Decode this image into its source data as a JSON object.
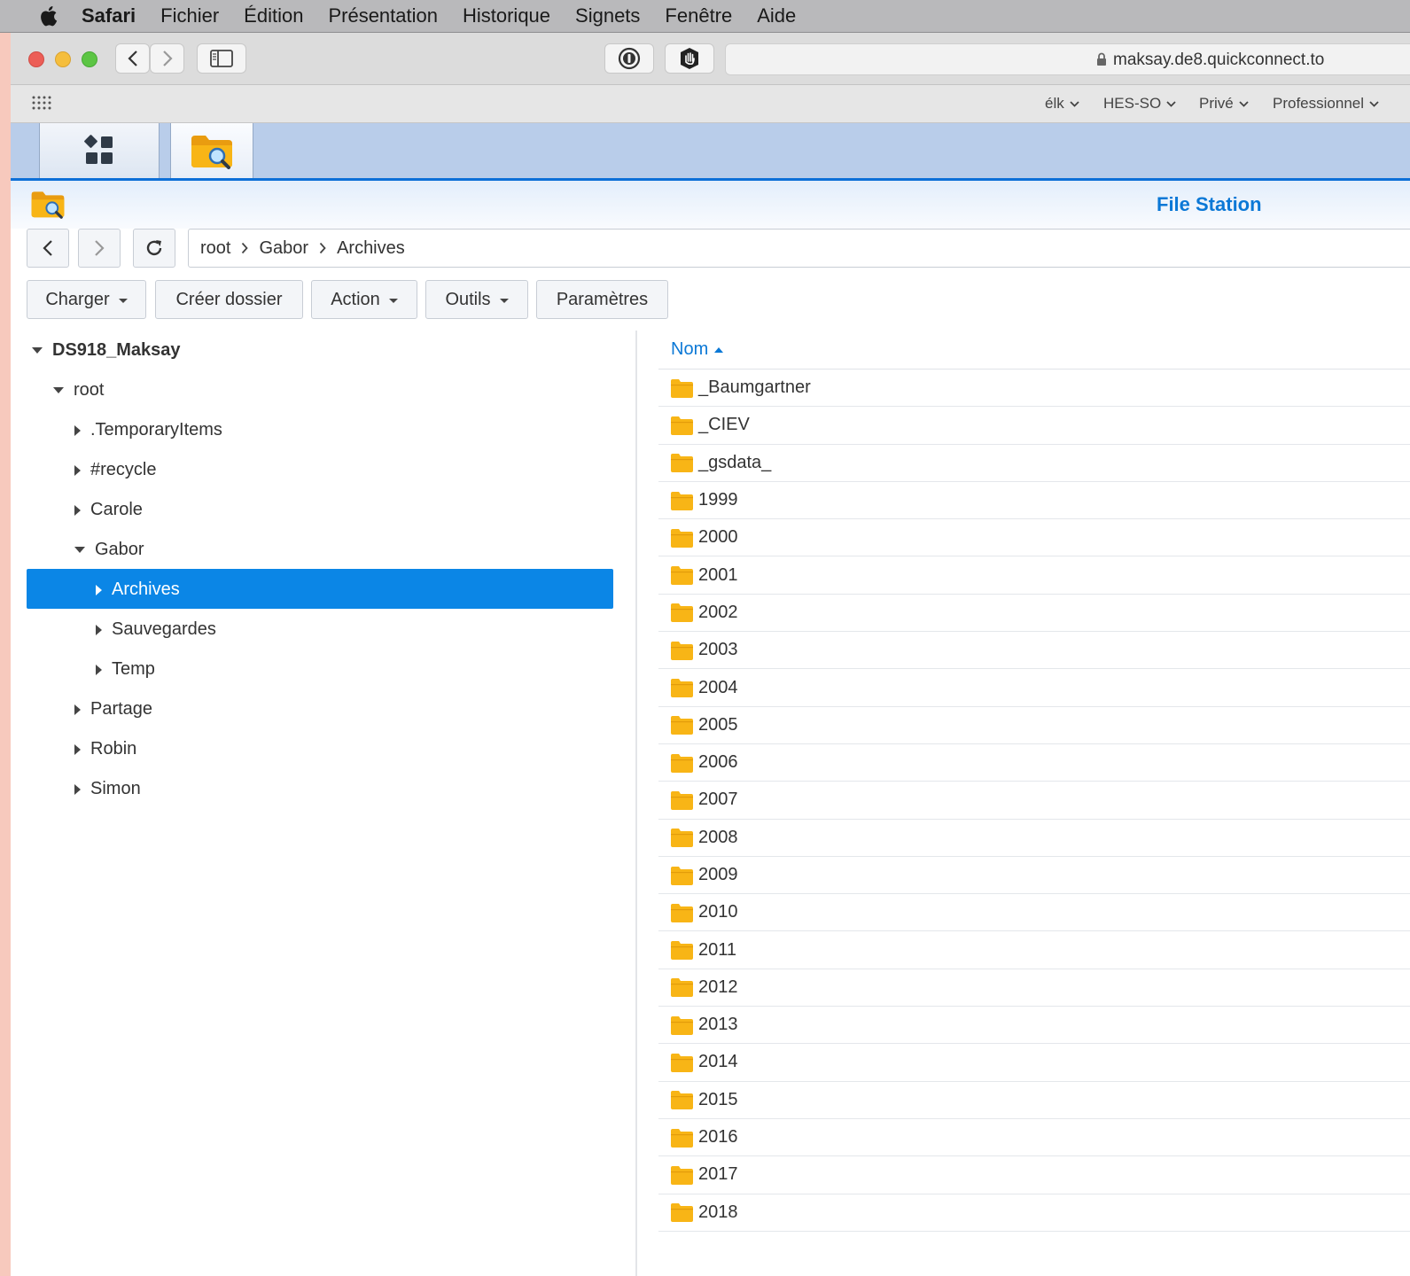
{
  "menubar": {
    "app_name": "Safari",
    "items": [
      "Fichier",
      "Édition",
      "Présentation",
      "Historique",
      "Signets",
      "Fenêtre",
      "Aide"
    ]
  },
  "browser": {
    "url": "maksay.de8.quickconnect.to",
    "favorites": [
      "élk",
      "HES-SO",
      "Privé",
      "Professionnel"
    ]
  },
  "dsm": {
    "app_title": "File Station",
    "breadcrumb": [
      "root",
      "Gabor",
      "Archives"
    ],
    "actions": [
      {
        "label": "Charger",
        "dropdown": true
      },
      {
        "label": "Créer dossier",
        "dropdown": false
      },
      {
        "label": "Action",
        "dropdown": true
      },
      {
        "label": "Outils",
        "dropdown": true
      },
      {
        "label": "Paramètres",
        "dropdown": false
      }
    ],
    "tree": [
      {
        "label": "DS918_Maksay",
        "level": 0,
        "expanded": true,
        "bold": true
      },
      {
        "label": "root",
        "level": 1,
        "expanded": true
      },
      {
        "label": ".TemporaryItems",
        "level": 2,
        "expanded": false
      },
      {
        "label": "#recycle",
        "level": 2,
        "expanded": false
      },
      {
        "label": "Carole",
        "level": 2,
        "expanded": false
      },
      {
        "label": "Gabor",
        "level": 2,
        "expanded": true
      },
      {
        "label": "Archives",
        "level": 3,
        "expanded": false,
        "selected": true
      },
      {
        "label": "Sauvegardes",
        "level": 3,
        "expanded": false
      },
      {
        "label": "Temp",
        "level": 3,
        "expanded": false
      },
      {
        "label": "Partage",
        "level": 2,
        "expanded": false
      },
      {
        "label": "Robin",
        "level": 2,
        "expanded": false
      },
      {
        "label": "Simon",
        "level": 2,
        "expanded": false
      }
    ],
    "list_header": "Nom",
    "files": [
      "_Baumgartner",
      "_CIEV",
      "_gsdata_",
      "1999",
      "2000",
      "2001",
      "2002",
      "2003",
      "2004",
      "2005",
      "2006",
      "2007",
      "2008",
      "2009",
      "2010",
      "2011",
      "2012",
      "2013",
      "2014",
      "2015",
      "2016",
      "2017",
      "2018"
    ]
  },
  "colors": {
    "accent": "#0b78d6",
    "selection": "#0b86e6",
    "folder": "#f8b516",
    "taskbar": "#b9cdea"
  }
}
